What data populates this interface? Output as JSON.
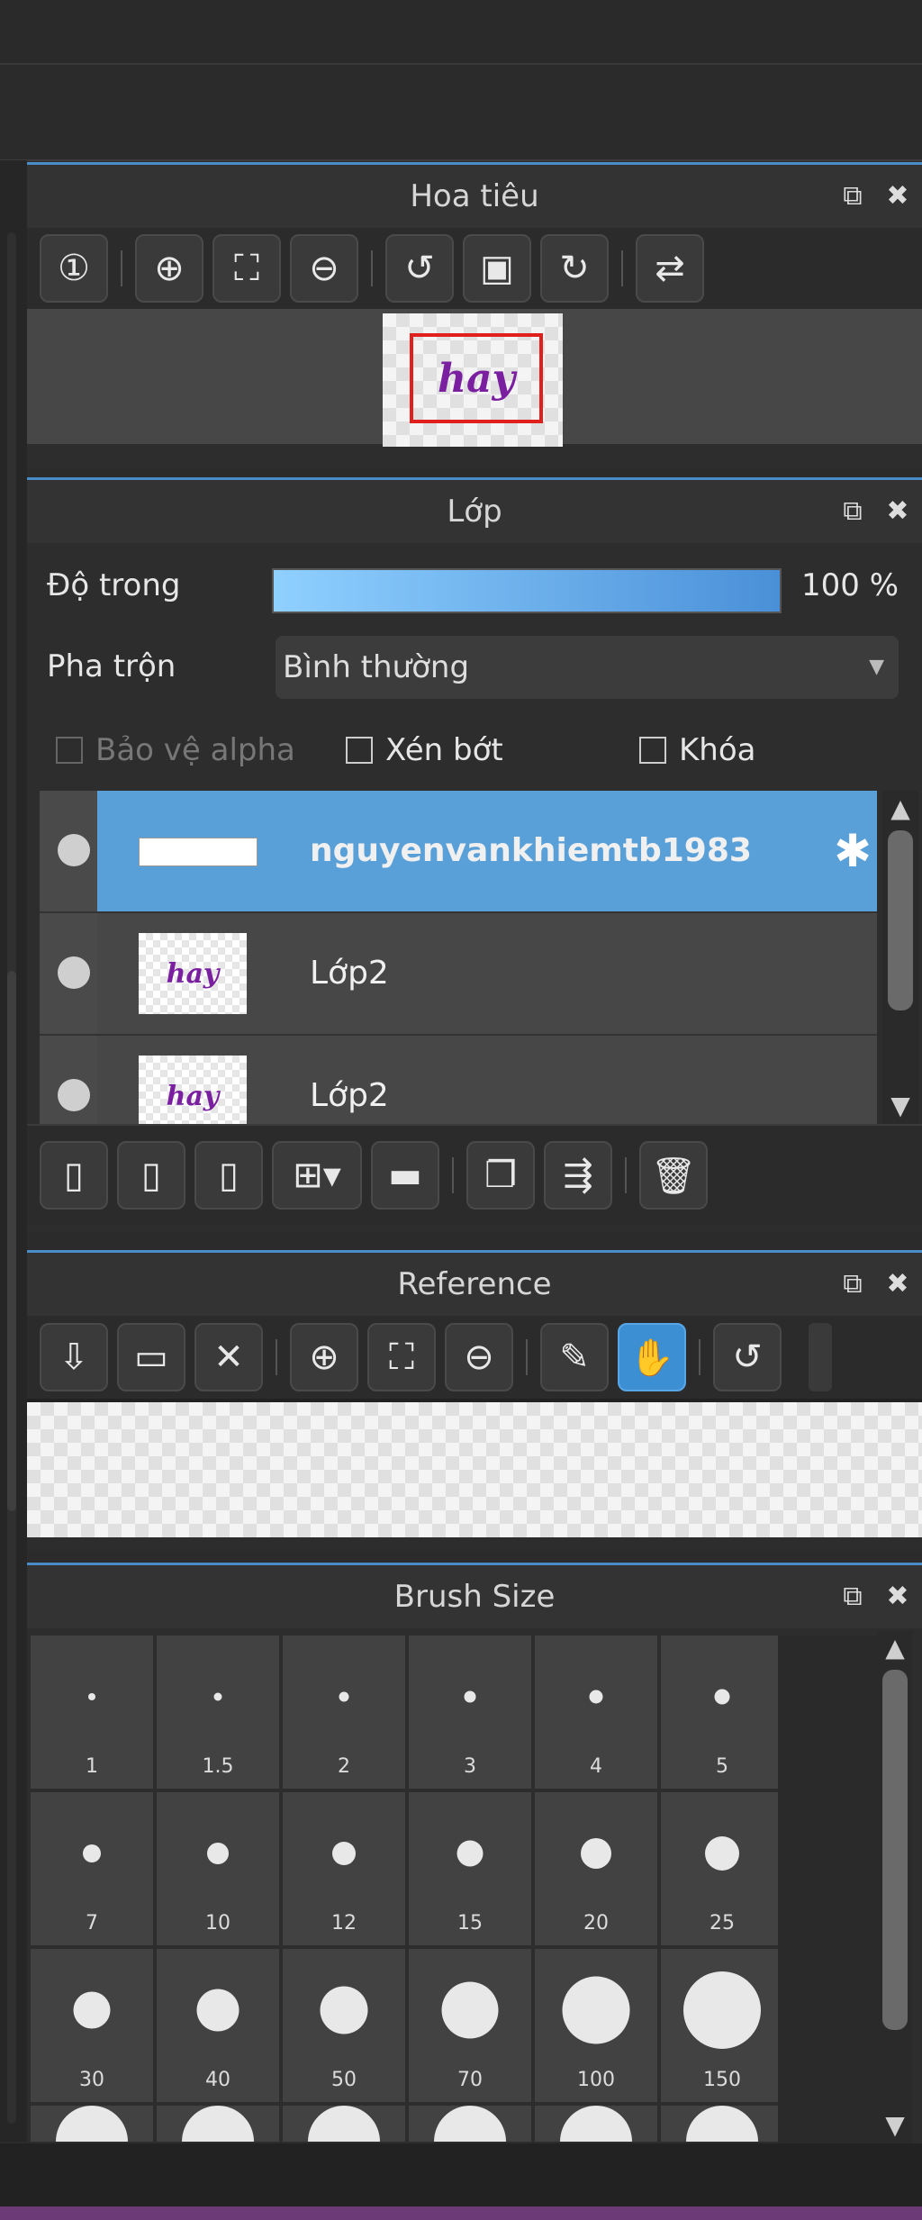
{
  "navigator": {
    "title": "Hoa tiêu",
    "tools": [
      "zoom-actual-icon",
      "zoom-in-icon",
      "fit-screen-icon",
      "zoom-out-icon",
      "rotate-left-icon",
      "fullscreen-icon",
      "rotate-right-icon",
      "flip-icon"
    ],
    "preview_text": "hay"
  },
  "layers": {
    "title": "Lớp",
    "opacity_label": "Độ trong",
    "opacity_value": "100 %",
    "opacity_fraction": 1.0,
    "blend_label": "Pha trộn",
    "blend_value": "Bình thường",
    "protect_alpha_label": "Bảo vệ alpha",
    "clip_label": "Xén bớt",
    "lock_label": "Khóa",
    "items": [
      {
        "name": "nguyenvankhiemtb1983",
        "selected": true
      },
      {
        "name": "Lớp2",
        "selected": false
      },
      {
        "name": "Lớp2",
        "selected": false
      }
    ],
    "thumb_text": "hay"
  },
  "reference": {
    "title": "Reference"
  },
  "brush_size": {
    "title": "Brush Size",
    "sizes": [
      "1",
      "1.5",
      "2",
      "3",
      "4",
      "5",
      "7",
      "10",
      "12",
      "15",
      "20",
      "25",
      "30",
      "40",
      "50",
      "70",
      "100",
      "150"
    ]
  }
}
